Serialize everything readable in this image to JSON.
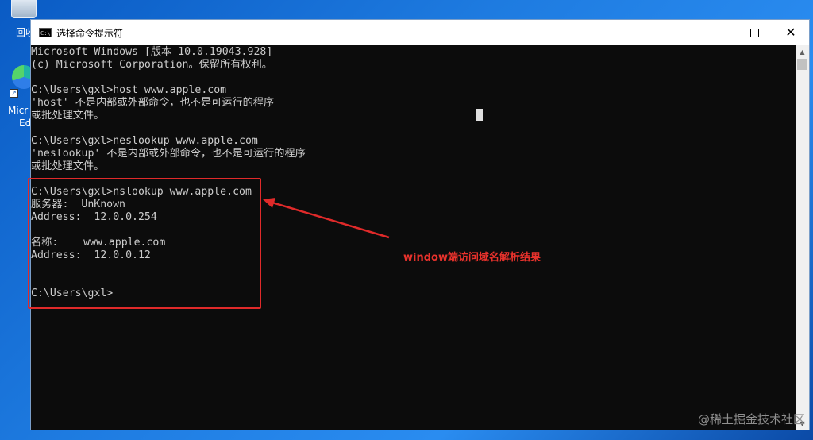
{
  "desktop": {
    "recycle_label": "回收",
    "edge_label_1": "Micr",
    "edge_label_2": "Ed"
  },
  "window": {
    "title": "选择命令提示符",
    "icon_text": "C:\\",
    "controls": {
      "minimize": "",
      "maximize": "",
      "close": "✕"
    }
  },
  "console": {
    "lines": [
      "Microsoft Windows [版本 10.0.19043.928]",
      "(c) Microsoft Corporation。保留所有权利。",
      "",
      "C:\\Users\\gxl>host www.apple.com",
      "'host' 不是内部或外部命令，也不是可运行的程序",
      "或批处理文件。",
      "",
      "C:\\Users\\gxl>neslookup www.apple.com",
      "'neslookup' 不是内部或外部命令，也不是可运行的程序",
      "或批处理文件。",
      "",
      "C:\\Users\\gxl>nslookup www.apple.com",
      "服务器:  UnKnown",
      "Address:  12.0.0.254",
      "",
      "名称:    www.apple.com",
      "Address:  12.0.0.12",
      "",
      "",
      "C:\\Users\\gxl>"
    ]
  },
  "annotation": {
    "label": "window端访问域名解析结果",
    "color": "#e02a2a"
  },
  "watermark": "@稀土掘金技术社区"
}
